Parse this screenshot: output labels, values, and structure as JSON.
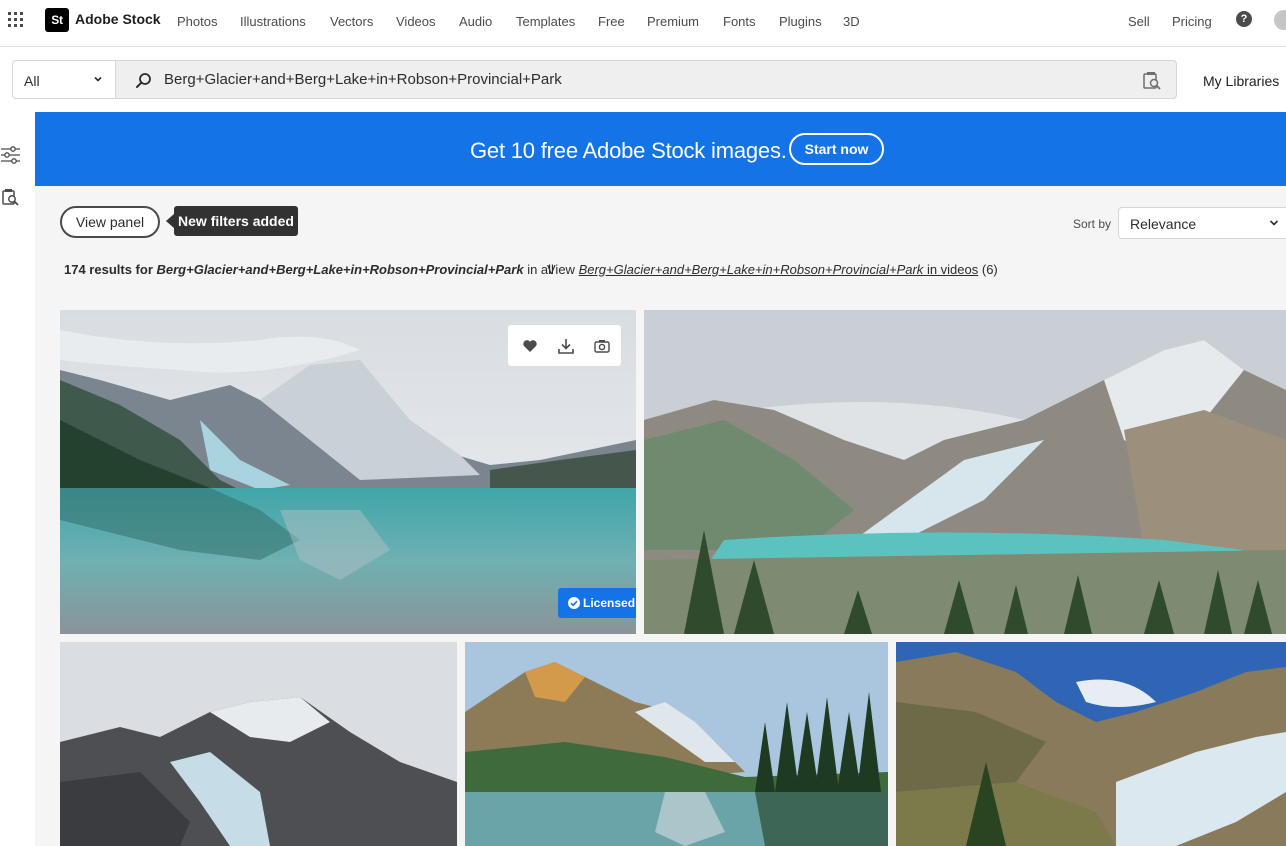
{
  "brand": {
    "logo_text": "St",
    "name": "Adobe Stock"
  },
  "nav": {
    "items": [
      "Photos",
      "Illustrations",
      "Vectors",
      "Videos",
      "Audio",
      "Templates",
      "Free",
      "Premium",
      "Fonts",
      "Plugins",
      "3D"
    ],
    "sell": "Sell",
    "pricing": "Pricing",
    "help_icon": "question-icon"
  },
  "search": {
    "scope": "All",
    "query": "Berg+Glacier+and+Berg+Lake+in+Robson+Provincial+Park",
    "my_libraries": "My Libraries"
  },
  "banner": {
    "text": "Get 10 free Adobe Stock images.",
    "button": "Start now",
    "color": "#1473e6"
  },
  "controls": {
    "view_panel": "View panel",
    "tooltip": "New filters added",
    "sort_label": "Sort by",
    "sort_value": "Relevance"
  },
  "results": {
    "count_text": "174 results for",
    "query": "Berg+Glacier+and+Berg+Lake+in+Robson+Provincial+Park",
    "suffix": "in all",
    "view_prefix": "View",
    "video_link_suffix": "in videos",
    "video_count": "(6)"
  },
  "tiles": {
    "badge": "Licensed",
    "actions": [
      "heart-icon",
      "download-icon",
      "camera-icon"
    ]
  }
}
